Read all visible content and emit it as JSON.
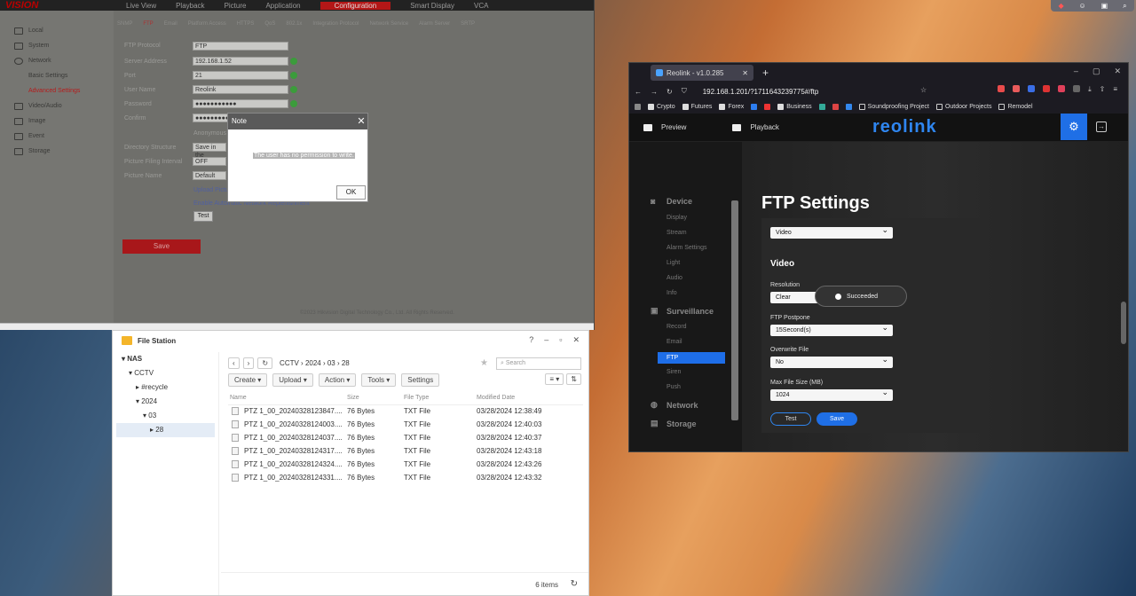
{
  "hik": {
    "logo": "VISION",
    "top_tabs": [
      "Live View",
      "Playback",
      "Picture",
      "Application",
      "Configuration",
      "Smart Display",
      "VCA"
    ],
    "sidebar": [
      {
        "label": "Local",
        "icon": "monitor-icon"
      },
      {
        "label": "System",
        "icon": "system-icon"
      },
      {
        "label": "Network",
        "icon": "globe-icon"
      },
      {
        "label": "Basic Settings",
        "sub": true
      },
      {
        "label": "Advanced Settings",
        "sub": true,
        "active": true
      },
      {
        "label": "Video/Audio",
        "icon": "video-icon"
      },
      {
        "label": "Image",
        "icon": "image-icon"
      },
      {
        "label": "Event",
        "icon": "event-icon"
      },
      {
        "label": "Storage",
        "icon": "storage-icon"
      }
    ],
    "subtabs": [
      "SNMP",
      "FTP",
      "Email",
      "Platform Access",
      "HTTPS",
      "QoS",
      "802.1x",
      "Integration Protocol",
      "Network Service",
      "Alarm Server",
      "SRTP"
    ],
    "form": {
      "protocol_label": "FTP Protocol",
      "protocol_value": "FTP",
      "address_label": "Server Address",
      "address_value": "192.168.1.52",
      "port_label": "Port",
      "port_value": "21",
      "user_label": "User Name",
      "user_value": "Reolink",
      "password_label": "Password",
      "password_value": "●●●●●●●●●●●",
      "confirm_label": "Confirm",
      "confirm_value": "●●●●●●●●●●●",
      "anon_label": "Anonymous",
      "dir_label": "Directory Structure",
      "dir_value": "Save in the",
      "pic_label": "Picture Filing Interval",
      "pic_value": "OFF",
      "name_label": "Picture Name",
      "name_value": "Default",
      "upload_label": "Upload Picture",
      "enable_label": "Enable Automatic Network Replenishment",
      "test_label": "Test",
      "save_label": "Save"
    },
    "copyright": "©2023 Hikvision Digital Technology Co., Ltd. All Rights Reserved."
  },
  "note": {
    "title": "Note",
    "message": "The user has no permission to write.",
    "ok": "OK"
  },
  "fs": {
    "title": "File Station",
    "tree": [
      "NAS",
      "CCTV",
      "#recycle",
      "2024",
      "03",
      "28"
    ],
    "path": [
      "CCTV",
      "2024",
      "03",
      "28"
    ],
    "search_placeholder": "Search",
    "buttons": {
      "create": "Create",
      "upload": "Upload",
      "action": "Action",
      "tools": "Tools",
      "settings": "Settings"
    },
    "columns": {
      "name": "Name",
      "size": "Size",
      "type": "File Type",
      "modified": "Modified Date"
    },
    "rows": [
      {
        "name": "PTZ 1_00_20240328123847....",
        "size": "76 Bytes",
        "type": "TXT File",
        "date": "03/28/2024 12:38:49"
      },
      {
        "name": "PTZ 1_00_20240328124003....",
        "size": "76 Bytes",
        "type": "TXT File",
        "date": "03/28/2024 12:40:03"
      },
      {
        "name": "PTZ 1_00_20240328124037....",
        "size": "76 Bytes",
        "type": "TXT File",
        "date": "03/28/2024 12:40:37"
      },
      {
        "name": "PTZ 1_00_20240328124317....",
        "size": "76 Bytes",
        "type": "TXT File",
        "date": "03/28/2024 12:43:18"
      },
      {
        "name": "PTZ 1_00_20240328124324....",
        "size": "76 Bytes",
        "type": "TXT File",
        "date": "03/28/2024 12:43:26"
      },
      {
        "name": "PTZ 1_00_20240328124331....",
        "size": "76 Bytes",
        "type": "TXT File",
        "date": "03/28/2024 12:43:32"
      }
    ],
    "count": "6 items"
  },
  "ff": {
    "tab_title": "Reolink - v1.0.285",
    "url": "192.168.1.201/?1711643239775#/ftp",
    "bookmarks": [
      "Crypto",
      "Futures",
      "Forex",
      "Business",
      "Soundproofing Project",
      "Outdoor Projects",
      "Remodel"
    ]
  },
  "reolink": {
    "preview": "Preview",
    "playback": "Playback",
    "brand": "reolink",
    "nav_device": "Device",
    "device_items": [
      "Display",
      "Stream",
      "Alarm Settings",
      "Light",
      "Audio",
      "Info"
    ],
    "nav_surveillance": "Surveillance",
    "surv_items": [
      "Record",
      "Email",
      "FTP",
      "Siren",
      "Push"
    ],
    "nav_network": "Network",
    "nav_storage": "Storage",
    "page_title": "FTP Settings",
    "upload_type": "Video",
    "section": "Video",
    "resolution_label": "Resolution",
    "resolution_value": "Clear",
    "toast": "Succeeded",
    "postpone_label": "FTP Postpone",
    "postpone_value": "15Second(s)",
    "overwrite_label": "Overwrite File",
    "overwrite_value": "No",
    "maxsize_label": "Max File Size (MB)",
    "maxsize_value": "1024",
    "test": "Test",
    "save": "Save"
  }
}
